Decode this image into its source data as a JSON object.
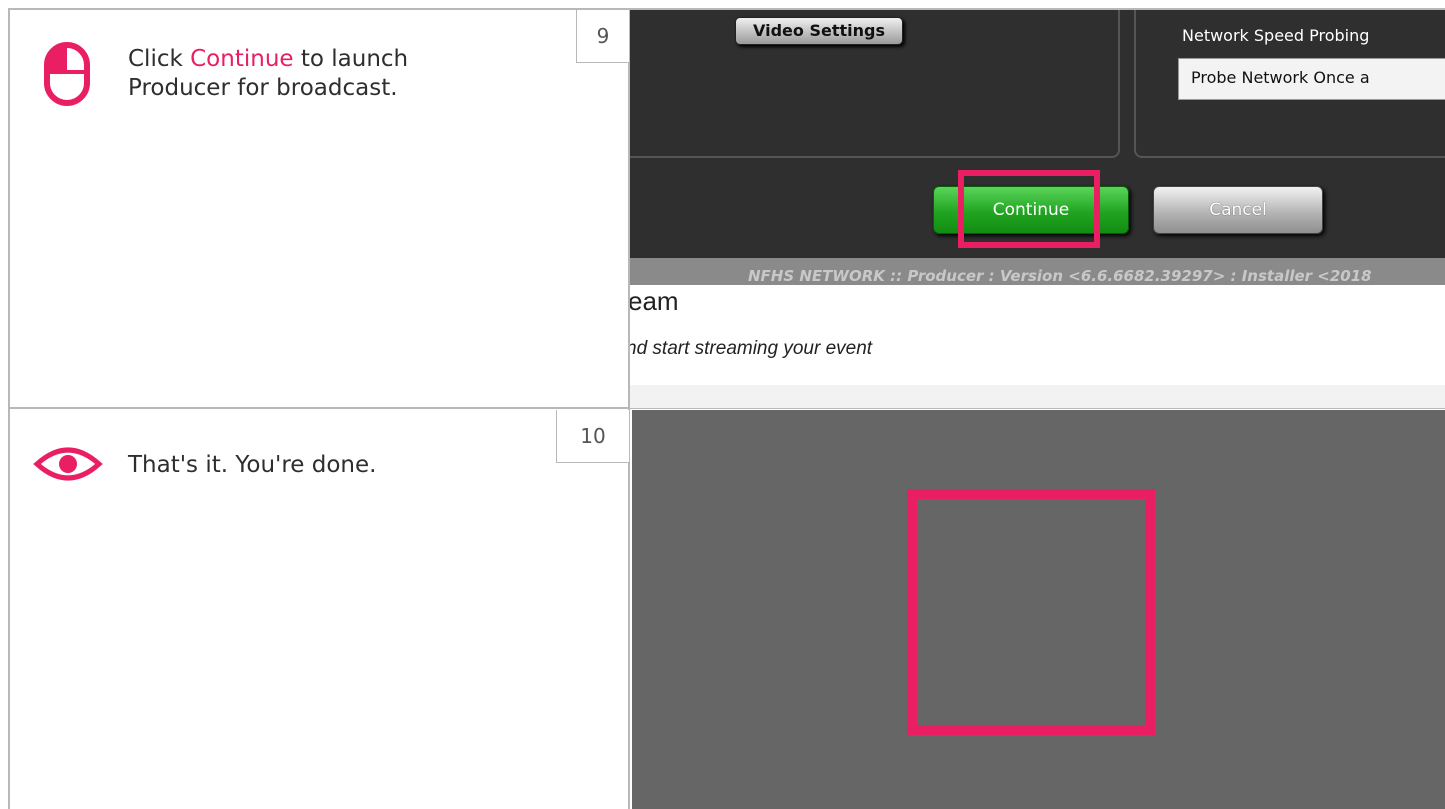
{
  "steps": [
    {
      "number": "9",
      "icon": "mouse-click-icon",
      "text_before": "Click ",
      "highlight": "Continue",
      "text_after": " to launch Producer for broadcast.",
      "screenshot": {
        "video_settings_button": "Video Settings",
        "network_speed_label": "Network Speed Probing",
        "network_speed_value": "Probe Network Once a",
        "continue_button": "Continue",
        "cancel_button": "Cancel",
        "footer_version": "NFHS NETWORK :: Producer : Version <6.6.6682.39297> : Installer <2018",
        "page_heading_fragment": "eam",
        "page_subtext_fragment": "nd start streaming your event"
      }
    },
    {
      "number": "10",
      "icon": "eye-icon",
      "text": "That's it. You're done."
    }
  ],
  "colors": {
    "accent": "#e91e63",
    "border": "#b8b8b8",
    "app_background": "#2f2f2f",
    "final_background": "#666666"
  }
}
